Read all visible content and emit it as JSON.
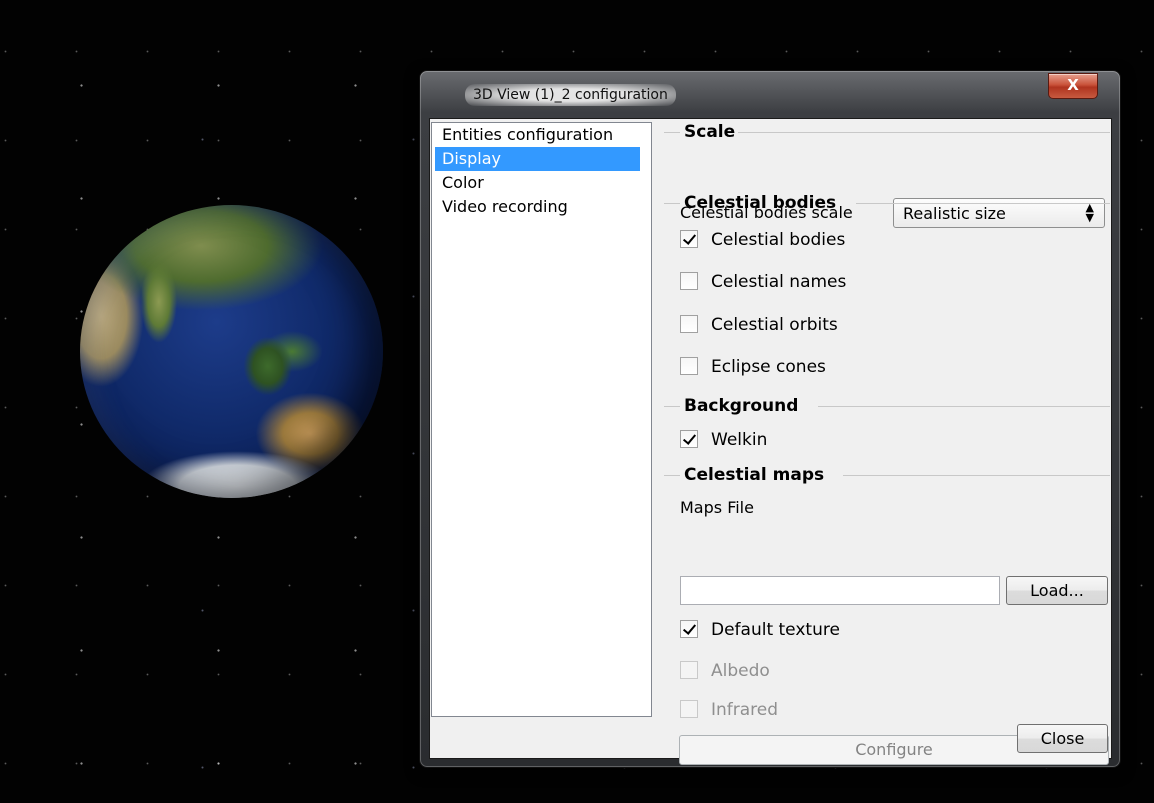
{
  "window": {
    "title": "3D View (1)_2 configuration",
    "close_glyph": "X"
  },
  "nav": {
    "items": [
      {
        "label": "Entities configuration",
        "selected": false
      },
      {
        "label": "Display",
        "selected": true
      },
      {
        "label": "Color",
        "selected": false
      },
      {
        "label": "Video recording",
        "selected": false
      }
    ]
  },
  "scale": {
    "title": "Scale",
    "celestial_scale_label": "Celestial bodies scale",
    "celestial_scale_value": "Realistic size"
  },
  "celestial_bodies": {
    "title": "Celestial bodies",
    "options": [
      {
        "label": "Celestial bodies",
        "checked": true
      },
      {
        "label": "Celestial names",
        "checked": false
      },
      {
        "label": "Celestial orbits",
        "checked": false
      },
      {
        "label": "Eclipse cones",
        "checked": false
      }
    ]
  },
  "background": {
    "title": "Background",
    "welkin_label": "Welkin",
    "welkin_checked": true
  },
  "celestial_maps": {
    "title": "Celestial maps",
    "maps_file_label": "Maps File",
    "maps_file_value": "",
    "load_label": "Load...",
    "default_texture_label": "Default texture",
    "default_texture_checked": true,
    "albedo_label": "Albedo",
    "albedo_checked": false,
    "infrared_label": "Infrared",
    "infrared_checked": false,
    "configure_label": "Configure"
  },
  "footer": {
    "close_label": "Close"
  },
  "icons": {
    "select_arrows": "updown-chevron-icon",
    "checkmark": "checkmark-icon"
  }
}
